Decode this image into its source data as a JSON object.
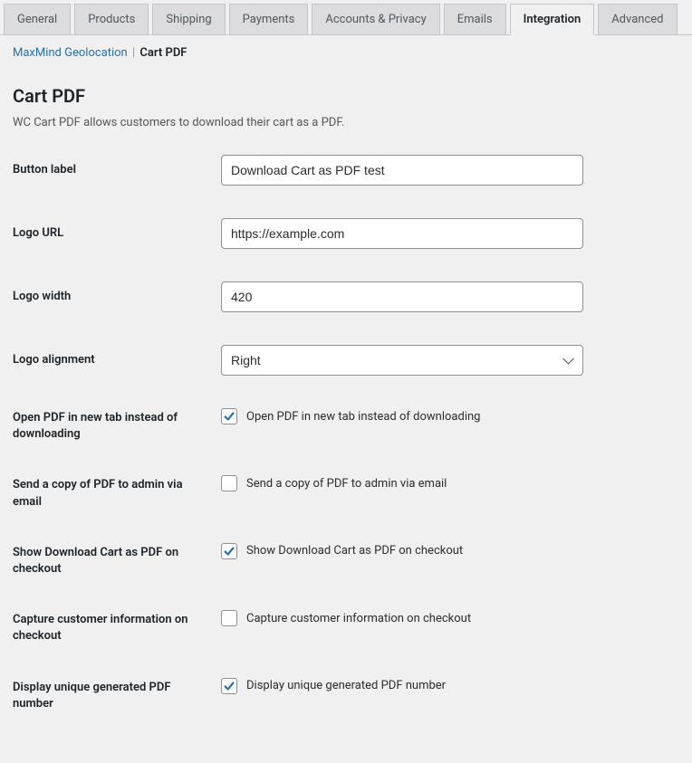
{
  "tabs": [
    {
      "label": "General",
      "active": false
    },
    {
      "label": "Products",
      "active": false
    },
    {
      "label": "Shipping",
      "active": false
    },
    {
      "label": "Payments",
      "active": false
    },
    {
      "label": "Accounts & Privacy",
      "active": false
    },
    {
      "label": "Emails",
      "active": false
    },
    {
      "label": "Integration",
      "active": true
    },
    {
      "label": "Advanced",
      "active": false
    }
  ],
  "subnav": {
    "link": "MaxMind Geolocation",
    "current": "Cart PDF"
  },
  "page": {
    "heading": "Cart PDF",
    "description": "WC Cart PDF allows customers to download their cart as a PDF."
  },
  "fields": {
    "button_label": {
      "label": "Button label",
      "value": "Download Cart as PDF test"
    },
    "logo_url": {
      "label": "Logo URL",
      "value": "https://example.com"
    },
    "logo_width": {
      "label": "Logo width",
      "value": "420"
    },
    "logo_alignment": {
      "label": "Logo alignment",
      "value": "Right"
    },
    "open_new_tab": {
      "label": "Open PDF in new tab instead of downloading",
      "checkbox_label": "Open PDF in new tab instead of downloading",
      "checked": true
    },
    "send_admin_email": {
      "label": "Send a copy of PDF to admin via email",
      "checkbox_label": "Send a copy of PDF to admin via email",
      "checked": false
    },
    "show_on_checkout": {
      "label": "Show Download Cart as PDF on checkout",
      "checkbox_label": "Show Download Cart as PDF on checkout",
      "checked": true
    },
    "capture_customer": {
      "label": "Capture customer information on checkout",
      "checkbox_label": "Capture customer information on checkout",
      "checked": false
    },
    "display_unique_number": {
      "label": "Display unique generated PDF number",
      "checkbox_label": "Display unique generated PDF number",
      "checked": true
    }
  }
}
